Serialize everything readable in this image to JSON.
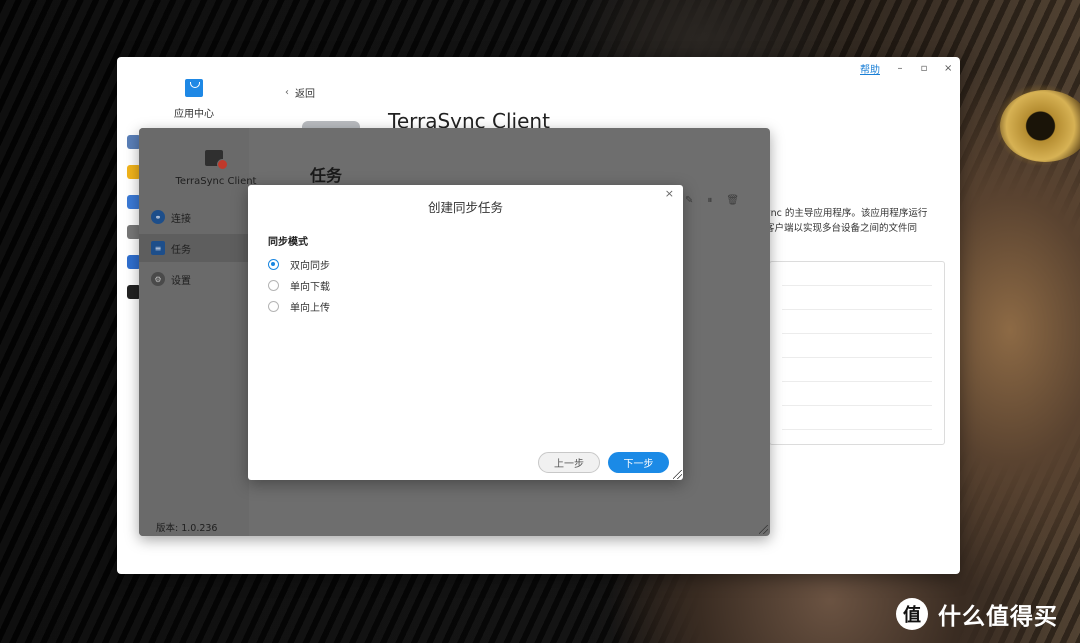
{
  "watermark": {
    "logo_glyph": "值",
    "text": "什么值得买"
  },
  "app_center": {
    "title": "应用中心",
    "help_label": "帮助",
    "controls": {
      "minimize": "–",
      "maximize": "▫",
      "close": "×"
    },
    "back_label": "返回",
    "app_title": "TerraSync Client",
    "description_lines": [
      "ync 的主导应用程序。该应用程序运行",
      "客户端以实现多台设备之间的文件同"
    ],
    "side_icon_colors": [
      "#5a7fb8",
      "#f2b41b",
      "#3b7ad6",
      "#777777",
      "#2f6fcf",
      "#222222"
    ]
  },
  "terrasync": {
    "name": "TerraSync Client",
    "heading": "任务",
    "nav": [
      {
        "label": "连接",
        "icon": "link-icon",
        "glyph": "⚭"
      },
      {
        "label": "任务",
        "icon": "task-list-icon",
        "glyph": "≡"
      },
      {
        "label": "设置",
        "icon": "gear-icon",
        "glyph": "⚙"
      }
    ],
    "version": "版本: 1.0.236",
    "toolbar_glyphs": {
      "edit": "✎",
      "pause": "⏸",
      "delete": "🗑"
    }
  },
  "dialog": {
    "title": "创建同步任务",
    "close_glyph": "×",
    "section_label": "同步模式",
    "options": [
      {
        "label": "双向同步",
        "checked": true
      },
      {
        "label": "单向下载",
        "checked": false
      },
      {
        "label": "单向上传",
        "checked": false
      }
    ],
    "prev_label": "上一步",
    "next_label": "下一步"
  }
}
